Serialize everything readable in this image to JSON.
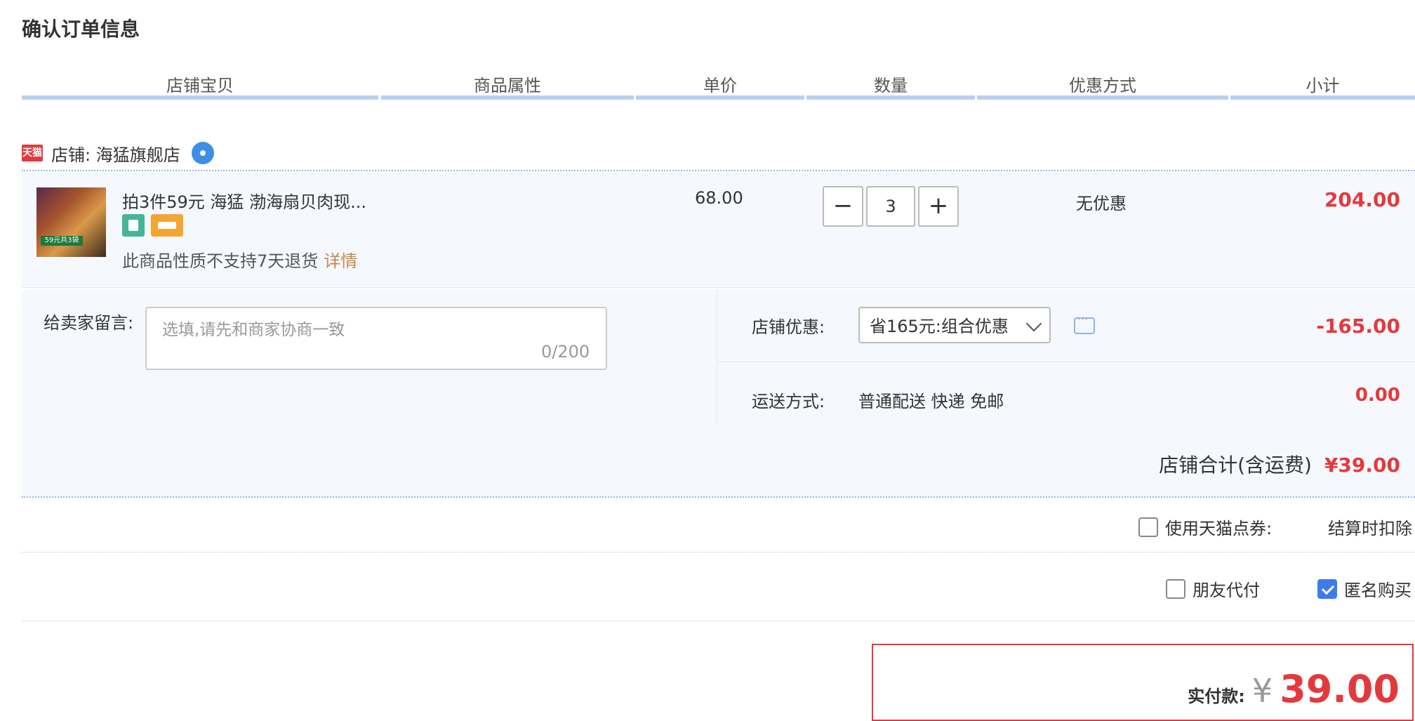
{
  "page": {
    "title": "确认订单信息"
  },
  "columns": [
    "店铺宝贝",
    "商品属性",
    "单价",
    "数量",
    "优惠方式",
    "小计"
  ],
  "shop": {
    "badge": "天猫",
    "label": "店铺: 海猛旗舰店"
  },
  "item": {
    "name": "拍3件59元 海猛 渤海扇贝肉现...",
    "thumb_text": "59元共3袋",
    "return_note": "此商品性质不支持7天退货",
    "detail_link": "详情",
    "unit_price": "68.00",
    "quantity": "3",
    "discount_method": "无优惠",
    "subtotal": "204.00"
  },
  "message": {
    "label": "给卖家留言:",
    "placeholder": "选填,请先和商家协商一致",
    "counter": "0/200"
  },
  "shop_discount": {
    "label": "店铺优惠:",
    "selected": "省165元:组合优惠",
    "amount": "-165.00"
  },
  "shipping": {
    "label": "运送方式:",
    "value": "普通配送 快递 免邮",
    "cost": "0.00"
  },
  "shop_total": {
    "label": "店铺合计(含运费)",
    "amount": "¥39.00"
  },
  "coupon": {
    "label": "使用天猫点券:",
    "value": "结算时扣除",
    "checked": false
  },
  "options": {
    "friend_pay": "朋友代付",
    "friend_pay_checked": false,
    "anonymous": "匿名购买",
    "anonymous_checked": true
  },
  "payment": {
    "label": "实付款:",
    "currency": "¥",
    "amount": "39.00"
  },
  "colors": {
    "accent_red": "#e4393c",
    "link_orange": "#c4894a",
    "header_bar": "#b7d0f0",
    "row_bg": "#f5f8fd",
    "check_blue": "#3d7bea"
  }
}
